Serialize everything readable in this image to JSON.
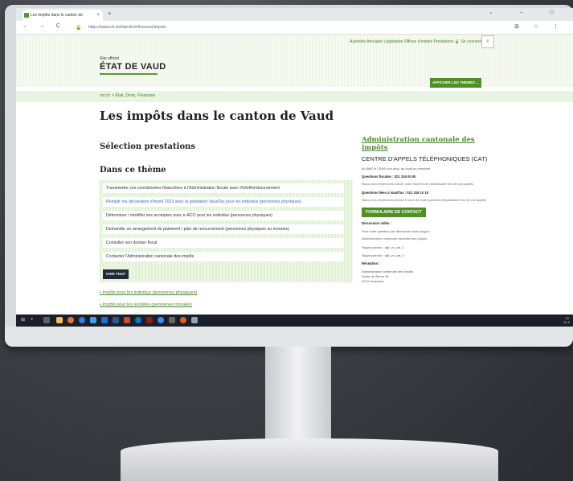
{
  "browser": {
    "tab_title": "Les impôts dans le canton de",
    "tab_close": "×",
    "new_tab": "+",
    "window_controls": "⌄ – ◻",
    "nav_controls": "← → C",
    "url": "https://www.vd.ch/etat-droit-finances/impots",
    "toolbar_icons": "⊞ ☆ ⋮"
  },
  "header": {
    "top_links": "Autorités  Annuaire  Législation  Offices d'emploi  Prestations  🔒 Se connecter",
    "site_official": "Site officiel",
    "logo": "ÉTAT DE VAUD",
    "themes_button": "AFFICHER LES THÈMES ⌄"
  },
  "breadcrumb": "vd.ch > État, Droit, Finances",
  "main": {
    "title": "Les impôts dans le canton de Vaud",
    "selection_heading": "Sélection prestations",
    "theme_heading": "Dans ce thème",
    "theme_items": [
      "Transmettre vos coordonnées financières à l'Administration fiscale avec #InfoRemboursement",
      "Remplir ma déclaration d'impôt 2023 avec la prestation VaudTax pour les individus (personnes physiques)",
      "Déterminer / modifier ses acomptes avec e-ACO pour les individus (personnes physiques)",
      "Demander un arrangement de paiement / plan de recouvrement (personnes physiques ou morales)",
      "Consulter son dossier fiscal",
      "Contacter l'Administration cantonale des impôts"
    ],
    "voir_tout": "VOIR TOUT",
    "bullet_links": [
      "Impôts pour les individus (personnes physiques)",
      "Impôts pour les sociétés (personnes morales)"
    ]
  },
  "sidebar": {
    "title": "Administration cantonale des impôts",
    "subtitle": "CENTRE D'APPELS TÉLÉPHONIQUES (CAT)",
    "hours": "du 8h00 à 17h00 non-stop, du lundi au vendredi",
    "q_fiscales": "Questions fiscales :  021 316 00 00",
    "q_fiscales_note": "Nous vous remercions d'avoir votre numéro de contribuable lors de vos appels",
    "q_vaudtax": "Questions liées à VaudTax :  021 316 10 10",
    "q_vaudtax_note": "Nous vous remercions d'avoir le nom de votre système d'exploitation lors de vos appels",
    "contact_button": "FORMULAIRE DE CONTACT",
    "discussion": "Discussion vidéo :",
    "discussion_note": "Pour toute question par discussion vidéo-skype :",
    "admin_italic": "Administration cantonale vaudoise des impôts",
    "skype1": "Skype pseudo :   dgf_vd_cat_1",
    "skype2": "Skype pseudo :   dgf_vd_cat_2",
    "reception": "Réception :",
    "address1": "Administration cantonale des impôts",
    "address2": "Route de Berne 46",
    "address3": "1014 Lausanne"
  },
  "taskbar": {
    "start": "⊞",
    "search": "⌕",
    "clock_time": "12:",
    "clock_date": "01.0"
  },
  "colors": {
    "brand_green": "#4f8f23",
    "link_blue": "#3a6db0",
    "taskbar": "#1b1f2a"
  }
}
